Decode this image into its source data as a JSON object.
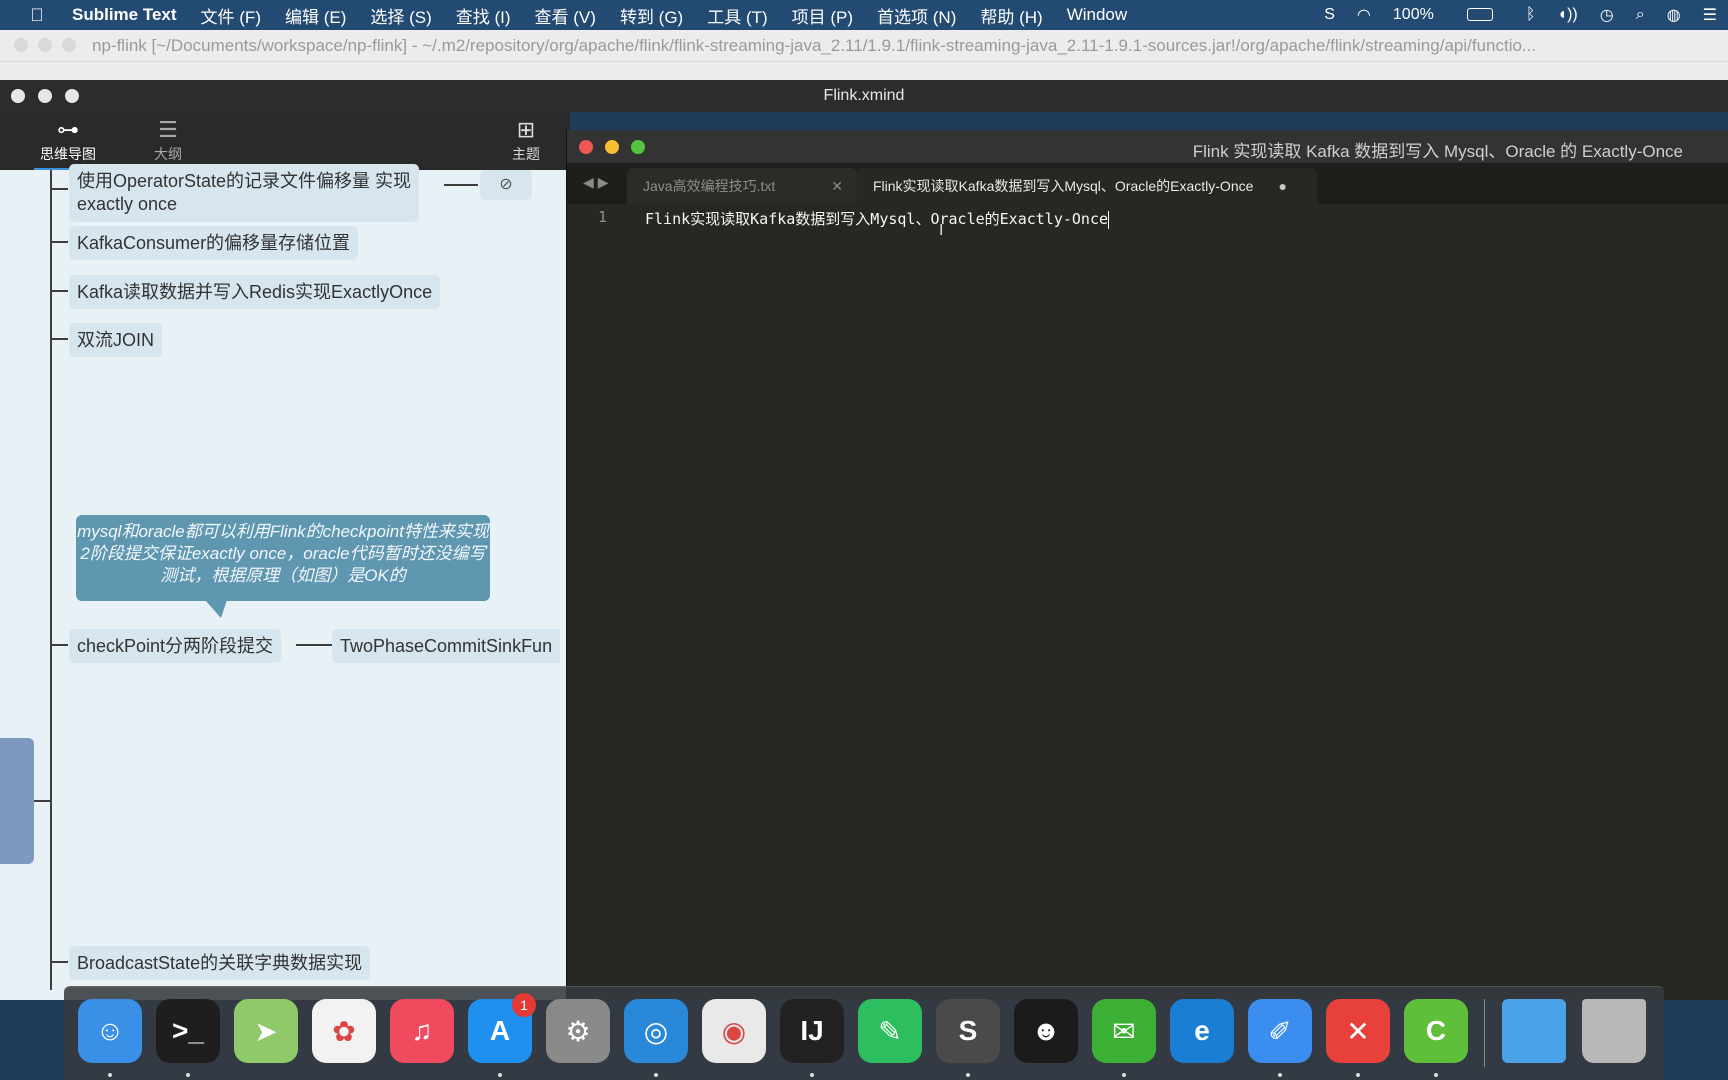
{
  "menubar": {
    "app_name": "Sublime Text",
    "items": [
      "文件 (F)",
      "编辑 (E)",
      "选择 (S)",
      "查找 (I)",
      "查看 (V)",
      "转到 (G)",
      "工具 (T)",
      "项目 (P)",
      "首选项 (N)",
      "帮助 (H)",
      "Window"
    ],
    "battery": "100%"
  },
  "idea": {
    "title": "np-flink [~/Documents/workspace/np-flink] - ~/.m2/repository/org/apache/flink/flink-streaming-java_2.11/1.9.1/flink-streaming-java_2.11-1.9.1-sources.jar!/org/apache/flink/streaming/api/functio..."
  },
  "xmind": {
    "title": "Flink.xmind",
    "tabs": [
      {
        "label": "思维导图",
        "icon": "mindmap-icon"
      },
      {
        "label": "大纲",
        "icon": "outline-icon"
      }
    ],
    "topic_label": "主题",
    "nodes": [
      "使用OperatorState的记录文件偏移量 实现\nexactly once",
      "KafkaConsumer的偏移量存储位置",
      "Kafka读取数据并写入Redis实现ExactlyOnce",
      "双流JOIN",
      "checkPoint分两阶段提交",
      "TwoPhaseCommitSinkFun",
      "BroadcastState的关联字典数据实现"
    ],
    "callout": "mysql和oracle都可以利用Flink的checkpoint特性来实现2阶段提交保证exactly once，oracle代码暂时还没编写测试，根据原理（如图）是OK的"
  },
  "sublime": {
    "title": "Flink 实现读取 Kafka 数据到写入 Mysql、Oracle 的 Exactly-Once",
    "tabs": [
      {
        "label": "Java高效编程技巧.txt",
        "active": false
      },
      {
        "label": "Flink实现读取Kafka数据到写入Mysql、Oracle的Exactly-Once",
        "active": true
      }
    ],
    "line_number": "1",
    "line_text": "Flink实现读取Kafka数据到写入Mysql、Oracle的Exactly-Once"
  },
  "dock": {
    "apps": [
      {
        "name": "Finder",
        "color": "#3a8fe6",
        "glyph": "☺"
      },
      {
        "name": "Terminal",
        "color": "#1e1e1e",
        "glyph": ">_"
      },
      {
        "name": "Maps",
        "color": "#8fc96a",
        "glyph": "➤"
      },
      {
        "name": "Photos",
        "color": "#f2f2f2",
        "glyph": "✿"
      },
      {
        "name": "Music",
        "color": "#f04a5e",
        "glyph": "♫"
      },
      {
        "name": "App Store",
        "color": "#1f8ff0",
        "glyph": "A",
        "badge": "1"
      },
      {
        "name": "System Preferences",
        "color": "#8a8a8a",
        "glyph": "⚙"
      },
      {
        "name": "Safari",
        "color": "#2a88d8",
        "glyph": "◎"
      },
      {
        "name": "Chrome",
        "color": "#e9e9e9",
        "glyph": "◉"
      },
      {
        "name": "IntelliJ IDEA",
        "color": "#222",
        "glyph": "IJ"
      },
      {
        "name": "Evernote",
        "color": "#2dbe60",
        "glyph": "✎"
      },
      {
        "name": "Sublime Text",
        "color": "#4a4a4a",
        "glyph": "S"
      },
      {
        "name": "QQ",
        "color": "#1b1b1b",
        "glyph": "☻"
      },
      {
        "name": "WeChat",
        "color": "#3cb034",
        "glyph": "✉"
      },
      {
        "name": "Edge",
        "color": "#1a7fd4",
        "glyph": "e"
      },
      {
        "name": "Markdown Editor",
        "color": "#3b8df0",
        "glyph": "✐"
      },
      {
        "name": "XMind",
        "color": "#e8403a",
        "glyph": "✕"
      },
      {
        "name": "Camtasia",
        "color": "#5fbf3a",
        "glyph": "C"
      }
    ],
    "folders": [
      {
        "name": "Downloads folder",
        "color": "#4aa3e8"
      },
      {
        "name": "Trash",
        "color": "#b8b8b8"
      }
    ]
  }
}
